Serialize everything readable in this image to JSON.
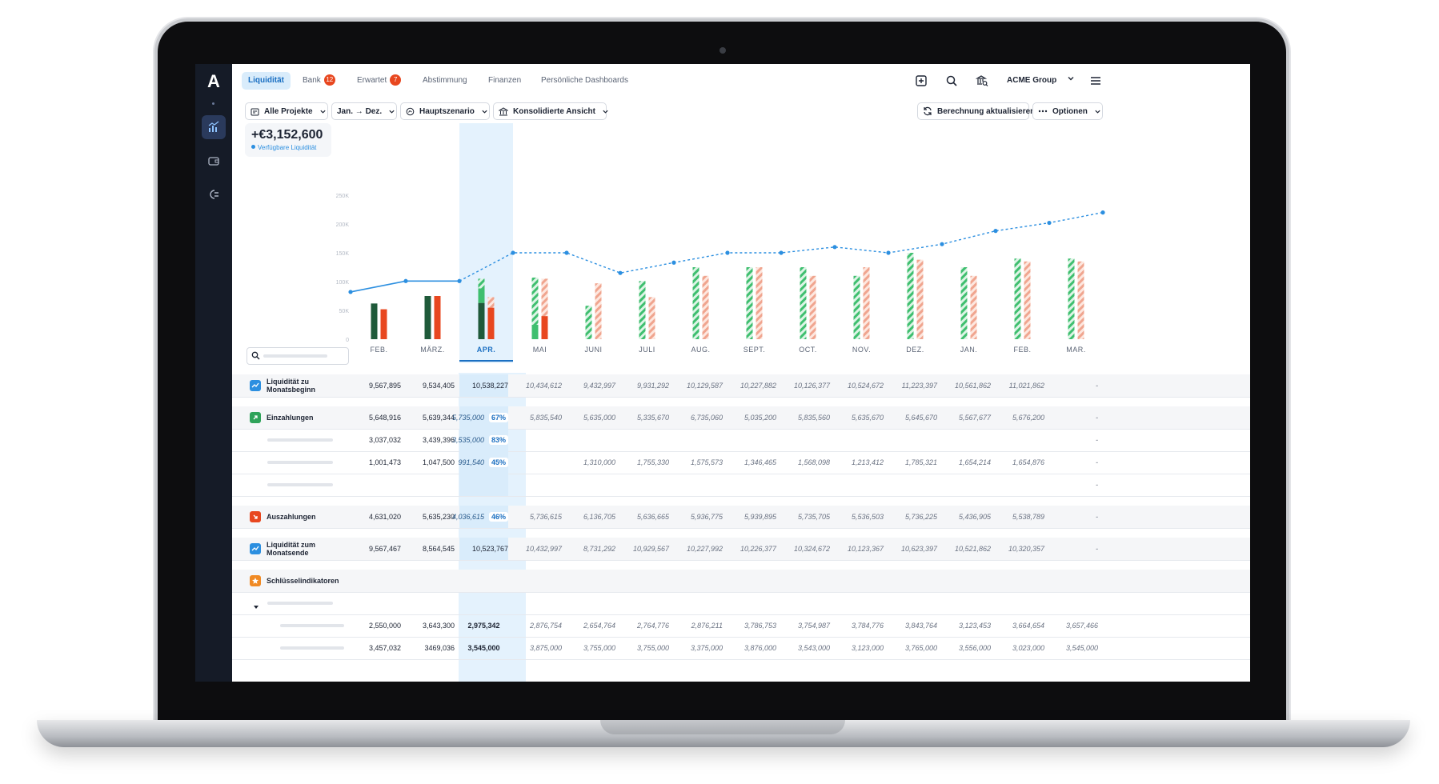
{
  "topnav": {
    "tabs": [
      {
        "label": "Liquidität",
        "active": true
      },
      {
        "label": "Bank",
        "badge": "12"
      },
      {
        "label": "Erwartet",
        "badge": "7"
      },
      {
        "label": "Abstimmung"
      },
      {
        "label": "Finanzen"
      },
      {
        "label": "Persönliche Dashboards"
      }
    ],
    "org_name": "ACME Group",
    "icons": [
      "plus-square-icon",
      "search-icon",
      "bank-search-icon",
      "chevron-down-icon",
      "menu-icon"
    ]
  },
  "filters": {
    "projects": "Alle Projekte",
    "period": "Jan. → Dez.",
    "scenario": "Hauptszenario",
    "view": "Konsolidierte Ansicht",
    "refresh": "Berechnung aktualisieren",
    "options": "Optionen"
  },
  "kpi": {
    "value": "+€3,152,600",
    "label": "Verfügbare Liquidität"
  },
  "colors": {
    "accent": "#2c8fe0",
    "in_actual": "#1f5a3a",
    "out_actual": "#e8471f",
    "in_forecast": "#3fbf6f",
    "out_forecast": "#f0a58f",
    "highlight": "#d9ecfb"
  },
  "chart_data": {
    "type": "bar",
    "categories": [
      "FEB.",
      "MÄRZ.",
      "APR.",
      "MAI",
      "JUNI",
      "JULI",
      "AUG.",
      "SEPT.",
      "OCT.",
      "NOV.",
      "DEZ.",
      "JAN.",
      "FEB.",
      "MAR."
    ],
    "y_ticks": [
      "250K",
      "200K",
      "150K",
      "100K",
      "50K",
      "0"
    ],
    "ylim": [
      0,
      250000
    ],
    "current_index": 2,
    "series": [],
    "bars": {
      "in": [
        62000,
        75000,
        105000,
        107000,
        58000,
        101000,
        125000,
        125000,
        125000,
        110000,
        150000,
        125000,
        140000,
        140000
      ],
      "out": [
        52000,
        75000,
        73000,
        105000,
        97000,
        73000,
        110000,
        125000,
        110000,
        125000,
        138000,
        110000,
        135000,
        135000
      ],
      "in_forecast_from": 2
    },
    "line": {
      "values": [
        82000,
        101000,
        101000,
        150000,
        150000,
        115000,
        133000,
        150000,
        150000,
        160000,
        150000,
        165000,
        188000,
        202000,
        220000
      ],
      "actual_until": 2
    }
  },
  "table": {
    "columns": [
      "FEB.",
      "MÄRZ.",
      "APR.",
      "MAI",
      "JUNI",
      "JULI",
      "AUG.",
      "SEPT.",
      "OCT.",
      "NOV.",
      "DEZ.",
      "JAN.",
      "FEB.",
      "MAR."
    ],
    "rows": [
      {
        "label": "Liquidität zu Monatsbeginn",
        "icon": "line-chart-icon",
        "values": [
          "9,567,895",
          "9,534,405",
          "10,538,227",
          "10,434,612",
          "9,432,997",
          "9,931,292",
          "10,129,587",
          "10,227,882",
          "10,126,377",
          "10,524,672",
          "11,223,397",
          "10,561,862",
          "11,021,862",
          "-"
        ]
      },
      {
        "label": "Einzahlungen",
        "icon": "arrow-up-right-icon",
        "values": [
          "5,648,916",
          "5,639,344",
          "5,735,000",
          "5,835,540",
          "5,635,000",
          "5,335,670",
          "6,735,060",
          "5,035,200",
          "5,835,560",
          "5,635,670",
          "5,645,670",
          "5,567,677",
          "5,676,200",
          "-"
        ],
        "pct": "67%"
      },
      {
        "label": "",
        "values": [
          "3,037,032",
          "3,439,396",
          "3,535,000",
          "",
          "",
          "",
          "",
          "",
          "",
          "",
          "",
          "",
          "",
          "-"
        ],
        "pct": "83%"
      },
      {
        "label": "",
        "values": [
          "1,001,473",
          "1,047,500",
          "991,540",
          "",
          "1,310,000",
          "1,755,330",
          "1,575,573",
          "1,346,465",
          "1,568,098",
          "1,213,412",
          "1,785,321",
          "1,654,214",
          "1,654,876",
          "-"
        ],
        "pct": "45%"
      },
      {
        "label": "",
        "values": [
          "",
          "",
          "",
          "",
          "",
          "",
          "",
          "",
          "",
          "",
          "",
          "",
          "",
          "-"
        ]
      },
      {
        "label": "Auszahlungen",
        "icon": "arrow-down-right-icon",
        "values": [
          "4,631,020",
          "5,635,230",
          "4,036,615",
          "5,736,615",
          "6,136,705",
          "5,636,665",
          "5,936,775",
          "5,939,895",
          "5,735,705",
          "5,536,503",
          "5,736,225",
          "5,436,905",
          "5,538,789",
          "-"
        ],
        "pct": "46%"
      },
      {
        "label": "Liquidität zum Monatsende",
        "icon": "line-chart-icon",
        "values": [
          "9,567,467",
          "8,564,545",
          "10,523,767",
          "10,432,997",
          "8,731,292",
          "10,929,567",
          "10,227,992",
          "10,226,377",
          "10,324,672",
          "10,123,367",
          "10,623,397",
          "10,521,862",
          "10,320,357",
          "-"
        ]
      },
      {
        "label": "Schlüsselindikatoren",
        "icon": "star-icon",
        "values": [
          "",
          "",
          "",
          "",
          "",
          "",
          "",
          "",
          "",
          "",
          "",
          "",
          "",
          ""
        ]
      },
      {
        "label": "",
        "values": [
          "",
          "",
          "",
          "",
          "",
          "",
          "",
          "",
          "",
          "",
          "",
          "",
          "",
          ""
        ]
      },
      {
        "label": "",
        "values": [
          "2,550,000",
          "3,643,300",
          "2,975,342",
          "2,876,754",
          "2,654,764",
          "2,764,776",
          "2,876,211",
          "3,786,753",
          "3,754,987",
          "3,784,776",
          "3,843,764",
          "3,123,453",
          "3,664,654",
          "3,657,466"
        ]
      },
      {
        "label": "",
        "values": [
          "3,457,032",
          "3469,036",
          "3,545,000",
          "3,875,000",
          "3,755,000",
          "3,755,000",
          "3,375,000",
          "3,876,000",
          "3,543,000",
          "3,123,000",
          "3,765,000",
          "3,556,000",
          "3,023,000",
          "3,545,000"
        ]
      }
    ]
  }
}
